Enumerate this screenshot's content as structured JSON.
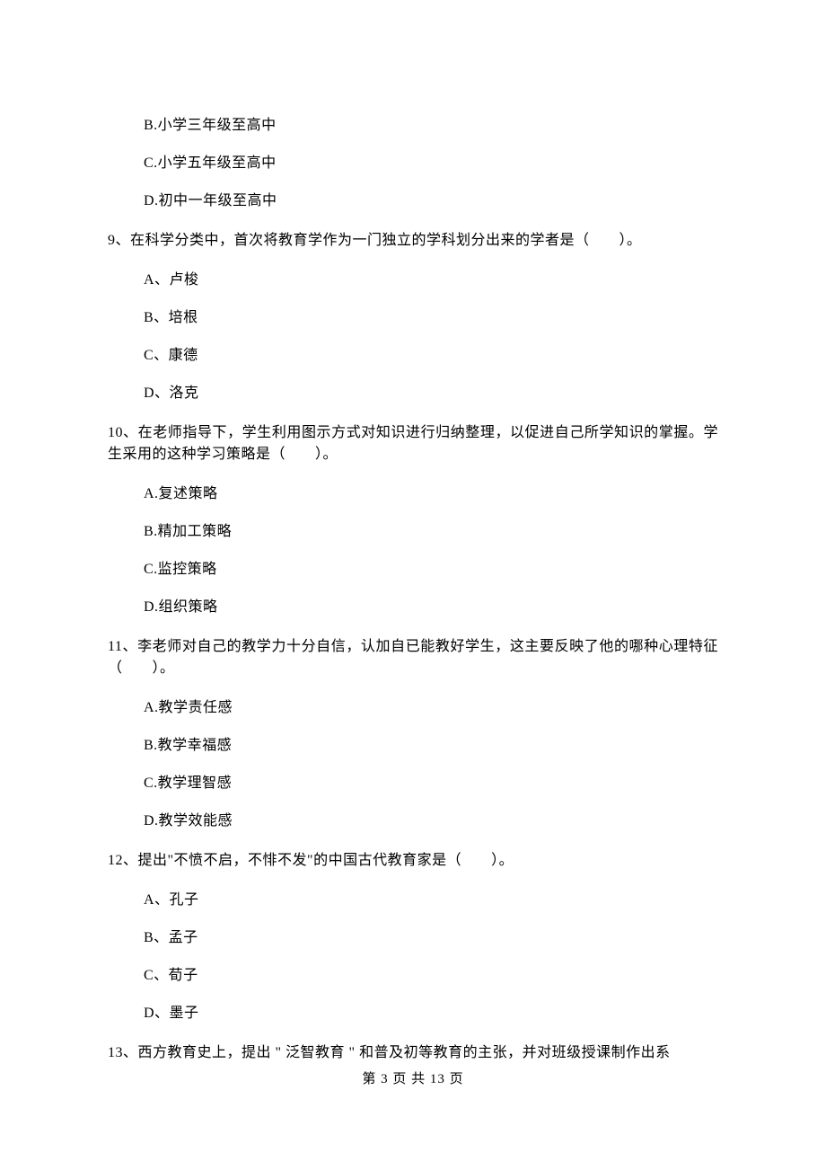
{
  "pretext_options": {
    "B": "B.小学三年级至高中",
    "C": "C.小学五年级至高中",
    "D": "D.初中一年级至高中"
  },
  "q9": {
    "stem": "9、在科学分类中，首次将教育学作为一门独立的学科划分出来的学者是（　　）。",
    "A": "A、卢梭",
    "B": "B、培根",
    "C": "C、康德",
    "D": "D、洛克"
  },
  "q10": {
    "stem": "10、在老师指导下，学生利用图示方式对知识进行归纳整理，以促进自己所学知识的掌握。学生采用的这种学习策略是（　　）。",
    "A": "A.复述策略",
    "B": "B.精加工策略",
    "C": "C.监控策略",
    "D": "D.组织策略"
  },
  "q11": {
    "stem": "11、李老师对自己的教学力十分自信，认加自已能教好学生，这主要反映了他的哪种心理特征（　　）。",
    "A": "A.教学责任感",
    "B": "B.教学幸福感",
    "C": "C.教学理智感",
    "D": "D.教学效能感"
  },
  "q12": {
    "stem": "12、提出\"不愤不启，不悱不发\"的中国古代教育家是（　　）。",
    "A": "A、孔子",
    "B": "B、孟子",
    "C": "C、荀子",
    "D": "D、墨子"
  },
  "q13": {
    "stem": "13、西方教育史上，提出 \" 泛智教育 \" 和普及初等教育的主张，并对班级授课制作出系"
  },
  "footer": "第 3 页 共 13 页"
}
